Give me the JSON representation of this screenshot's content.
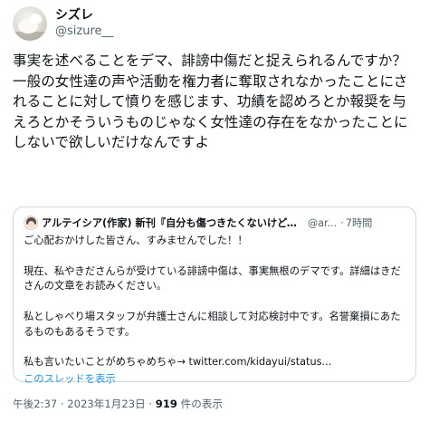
{
  "author": {
    "display_name": "シズレ",
    "handle": "@sizure__"
  },
  "tweet": {
    "text": "事実を述べることをデマ、誹謗中傷だと捉えられるんですか？\n一般の女性達の声や活動を権力者に奪取されなかったことにされることに対して憤りを感じます、功績を認めろとか報奨を与えろとかそういうものじゃなく女性達の存在をなかったことにしないで欲しいだけなんですよ"
  },
  "quote": {
    "name": "アルテイシア(作家) 新刊『自分も傷つきたくないけど、他人...",
    "handle": "@ar...",
    "separator": "·",
    "time": "7時間",
    "body": "ご心配おかけした皆さん、すみませんでした！！\n\n現在、私やきださんらが受けている誹謗中傷は、事実無根のデマです。詳細はきださんの文章をお読みください。\n\n私としゃべり場スタッフが弁護士さんに相談して対応検討中です。名誉棄損にあたるものもあるそうです。\n\n私も言いたいことがめちゃめちゃ→ twitter.com/kidayui/status...",
    "thread_link": "このスレッドを表示"
  },
  "meta": {
    "timestamp": "午後2:37 · 2023年1月23日 · ",
    "views_count": "919",
    "views_label": " 件の表示"
  }
}
